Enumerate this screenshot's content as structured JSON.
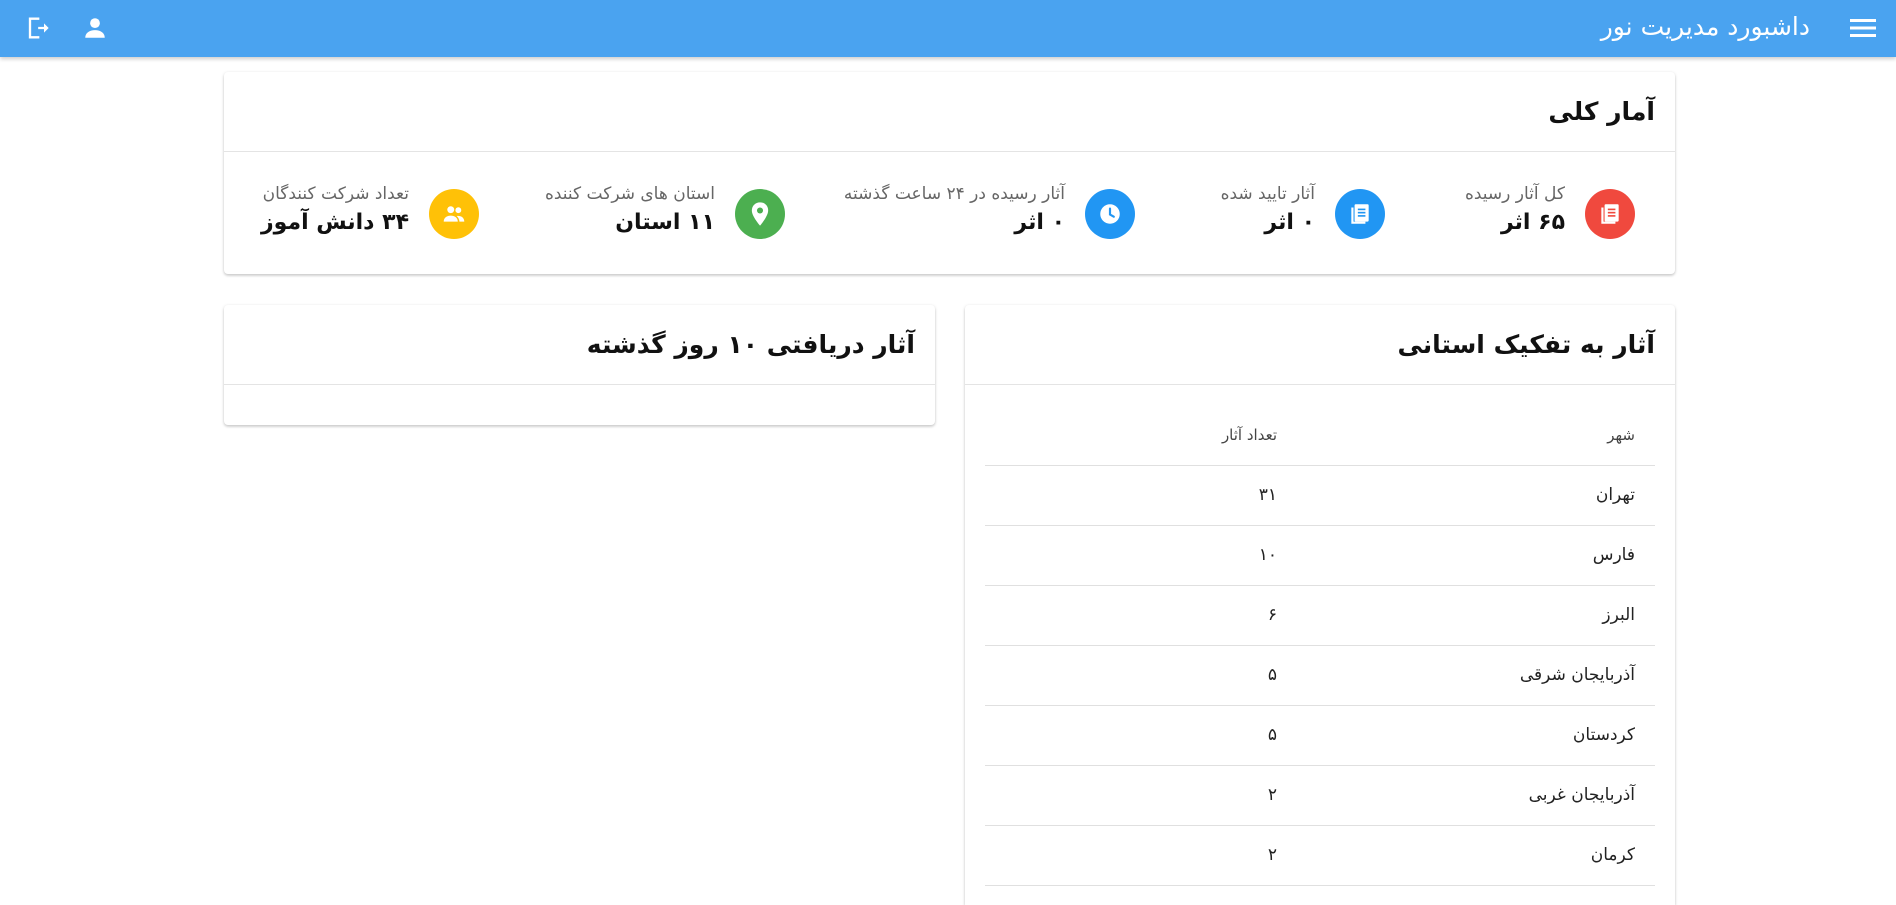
{
  "app": {
    "title": "داشبورد مدیریت نور"
  },
  "icons": {
    "menu": "menu-icon",
    "logout": "logout-icon",
    "account": "account-icon",
    "total": "book-stack-icon",
    "approved": "book-stack-icon",
    "recent": "clock-icon",
    "provinces": "location-pin-icon",
    "participants": "people-icon"
  },
  "colors": {
    "topbar": "#4aa3f0",
    "red": "#f0493e",
    "blue": "#2196f3",
    "green": "#4caf50",
    "yellow": "#ffc107"
  },
  "stats": {
    "title": "آمار کلی",
    "total": {
      "label": "کل آثار رسیده",
      "value": "۶۵ اثر"
    },
    "approved": {
      "label": "آثار تایید شده",
      "value": "۰ اثر"
    },
    "recent": {
      "label": "آثار رسیده در ۲۴ ساعت گذشته",
      "value": "۰ اثر"
    },
    "provinces": {
      "label": "استان های شرکت کننده",
      "value": "۱۱ استان"
    },
    "participants": {
      "label": "تعداد شرکت کنندگان",
      "value": "۳۴ دانش آموز"
    }
  },
  "province_table": {
    "title": "آثار به تفکیک استانی",
    "headers": {
      "city": "شهر",
      "count": "تعداد آثار"
    },
    "rows": [
      {
        "city": "تهران",
        "count": "۳۱"
      },
      {
        "city": "فارس",
        "count": "۱۰"
      },
      {
        "city": "البرز",
        "count": "۶"
      },
      {
        "city": "آذربایجان شرقی",
        "count": "۵"
      },
      {
        "city": "کردستان",
        "count": "۵"
      },
      {
        "city": "آذربایجان غربی",
        "count": "۲"
      },
      {
        "city": "کرمان",
        "count": "۲"
      }
    ]
  },
  "recent_card": {
    "title": "آثار دریافتی ۱۰ روز گذشته"
  }
}
